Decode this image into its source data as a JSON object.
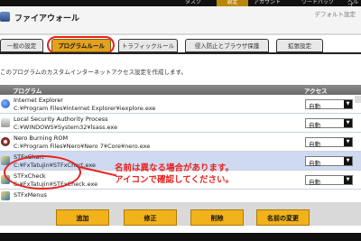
{
  "top_nav": {
    "tabs": [
      "タスク",
      "設定",
      "アカウント",
      "ワードパック",
      "ヘルプ"
    ],
    "active": "設定"
  },
  "header": {
    "title": "ファイアウォール",
    "default_link": "デフォルト設定"
  },
  "tabs": [
    {
      "label": "一般の設定",
      "active": false
    },
    {
      "label": "プログラムルール",
      "active": true
    },
    {
      "label": "トラフィックルール",
      "active": false
    },
    {
      "label": "侵入防止とブラウザ保護",
      "active": false
    },
    {
      "label": "拡張設定",
      "active": false
    }
  ],
  "description": "このプログラムのカスタムインターネットアクセス設定を作成します。",
  "table": {
    "headers": {
      "program": "プログラム",
      "access": "アクセス"
    },
    "rows": [
      {
        "name": "Internet Explorer",
        "path": "C:¥Program Files¥Internet Explorer¥iexplore.exe",
        "access": "自動"
      },
      {
        "name": "Local Security Authority Process",
        "path": "C:¥WINDOWS¥System32¥lsass.exe",
        "access": "自動"
      },
      {
        "name": "Nero Burning ROM",
        "path": "C:¥Program Files¥Nero¥Nero 7¥Core¥nero.exe",
        "access": "自動"
      },
      {
        "name": "STFxChart",
        "path": "C:¥FxTatujin¥STFxChart.exe",
        "access": "自動"
      },
      {
        "name": "STFxCheck",
        "path": "C:¥FxTatujin¥STFxCheck.exe",
        "access": "自動"
      },
      {
        "name": "STFxMenus",
        "path": "",
        "access": ""
      }
    ]
  },
  "annotation": {
    "line1": "名前は異なる場合があります。",
    "line2": "アイコンで確認してください。"
  },
  "buttons": {
    "add": "追加",
    "edit": "修正",
    "delete": "削除",
    "rename": "名前の変更"
  },
  "colors": {
    "accent": "#e2a21f",
    "callout": "#e8221d",
    "selected_row": "#cfdaf0"
  }
}
